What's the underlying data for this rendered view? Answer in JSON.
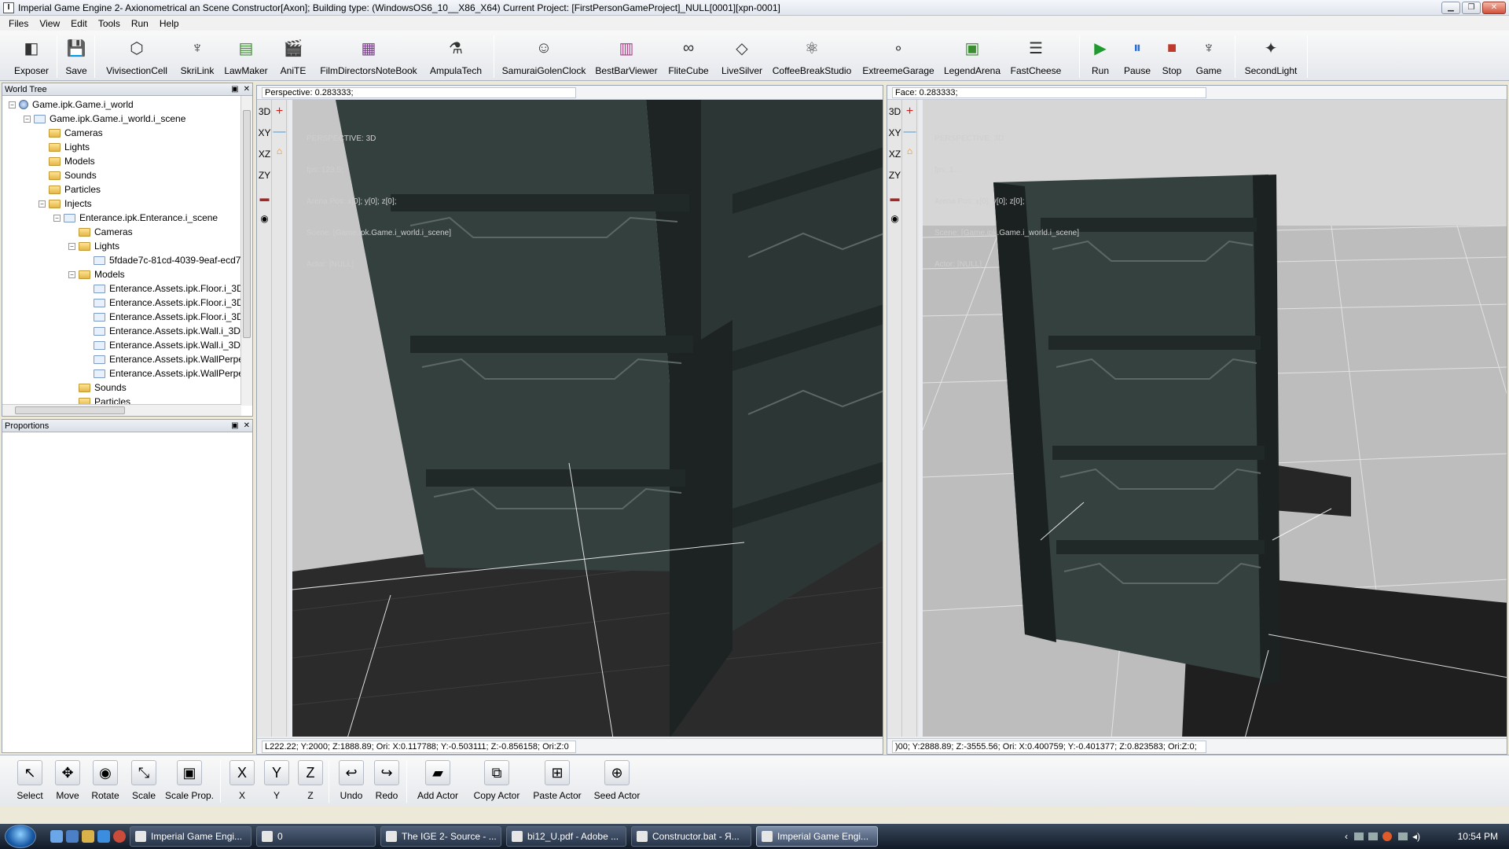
{
  "window": {
    "title": "Imperial Game Engine 2- Axionometrical an Scene Constructor[Axon]; Building type: (WindowsOS6_10__X86_X64) Current Project: [FirstPersonGameProject]_NULL[0001][xpn-0001]",
    "icon_letter": "I"
  },
  "menu": [
    "Files",
    "View",
    "Edit",
    "Tools",
    "Run",
    "Help"
  ],
  "toolbar": [
    {
      "label": "Exposer",
      "icon": "camera-icon"
    },
    {
      "label": "Save",
      "icon": "save-icon"
    },
    {
      "label": "VivisectionCell",
      "icon": "cube-icon"
    },
    {
      "label": "SkriLink",
      "icon": "eagle-icon"
    },
    {
      "label": "LawMaker",
      "icon": "chart-icon"
    },
    {
      "label": "AniTE",
      "icon": "clapperboard-icon"
    },
    {
      "label": "FilmDirectorsNoteBook",
      "icon": "film-icon"
    },
    {
      "label": "AmpulaTech",
      "icon": "ampule-icon"
    },
    {
      "label": "SamuraiGolenClock",
      "icon": "masks-icon"
    },
    {
      "label": "BestBarViewer",
      "icon": "glass-icon"
    },
    {
      "label": "FliteCube",
      "icon": "loop-icon"
    },
    {
      "label": "LiveSilver",
      "icon": "diamond-icon"
    },
    {
      "label": "CoffeeBreakStudio",
      "icon": "atom-icon"
    },
    {
      "label": "ExtreemeGarage",
      "icon": "spheres-icon"
    },
    {
      "label": "LegendArena",
      "icon": "arena-icon"
    },
    {
      "label": "FastCheese",
      "icon": "sliders-icon"
    },
    {
      "label": "Run",
      "icon": "run-icon"
    },
    {
      "label": "Pause",
      "icon": "pause-icon"
    },
    {
      "label": "Stop",
      "icon": "stop-icon"
    },
    {
      "label": "Game",
      "icon": "eagle-icon"
    },
    {
      "label": "SecondLight",
      "icon": "lamp-icon"
    }
  ],
  "world_tree": {
    "title": "World Tree",
    "items": [
      {
        "label": "Game.ipk.Game.i_world",
        "kind": "globe",
        "expander": "-",
        "indent": 0
      },
      {
        "label": "Game.ipk.Game.i_world.i_scene",
        "kind": "node",
        "expander": "-",
        "indent": 1
      },
      {
        "label": "Cameras",
        "kind": "folder",
        "expander": "",
        "indent": 2
      },
      {
        "label": "Lights",
        "kind": "folder",
        "expander": "",
        "indent": 2
      },
      {
        "label": "Models",
        "kind": "folder",
        "expander": "",
        "indent": 2
      },
      {
        "label": "Sounds",
        "kind": "folder",
        "expander": "",
        "indent": 2
      },
      {
        "label": "Particles",
        "kind": "folder",
        "expander": "",
        "indent": 2
      },
      {
        "label": "Injects",
        "kind": "folder",
        "expander": "-",
        "indent": 2
      },
      {
        "label": "Enterance.ipk.Enterance.i_scene",
        "kind": "node",
        "expander": "-",
        "indent": 3
      },
      {
        "label": "Cameras",
        "kind": "folder",
        "expander": "",
        "indent": 4
      },
      {
        "label": "Lights",
        "kind": "folder",
        "expander": "-",
        "indent": 4
      },
      {
        "label": "5fdade7c-81cd-4039-9eaf-ecd7",
        "kind": "node",
        "expander": "",
        "indent": 5
      },
      {
        "label": "Models",
        "kind": "folder",
        "expander": "-",
        "indent": 4
      },
      {
        "label": "Enterance.Assets.ipk.Floor.i_3D",
        "kind": "node",
        "expander": "",
        "indent": 5
      },
      {
        "label": "Enterance.Assets.ipk.Floor.i_3D",
        "kind": "node",
        "expander": "",
        "indent": 5
      },
      {
        "label": "Enterance.Assets.ipk.Floor.i_3D",
        "kind": "node",
        "expander": "",
        "indent": 5
      },
      {
        "label": "Enterance.Assets.ipk.Wall.i_3D_",
        "kind": "node",
        "expander": "",
        "indent": 5
      },
      {
        "label": "Enterance.Assets.ipk.Wall.i_3D_",
        "kind": "node",
        "expander": "",
        "indent": 5
      },
      {
        "label": "Enterance.Assets.ipk.WallPerpe",
        "kind": "node",
        "expander": "",
        "indent": 5
      },
      {
        "label": "Enterance.Assets.ipk.WallPerpe",
        "kind": "node",
        "expander": "",
        "indent": 5
      },
      {
        "label": "Sounds",
        "kind": "folder",
        "expander": "",
        "indent": 4
      },
      {
        "label": "Particles",
        "kind": "folder",
        "expander": "",
        "indent": 4
      }
    ]
  },
  "proportions": {
    "title": "Proportions"
  },
  "panel_buttons": {
    "dock": "▣",
    "close": "✕"
  },
  "viewport_left": {
    "header": "Perspective: 0.283333;",
    "status": "L222.22; Y:2000; Z:1888.89; Ori: X:0.117788; Y:-0.503111; Z:-0.856158; Ori:Z:0",
    "overlay": [
      "PERSPECTIVE: 3D",
      "fps: 123.5;",
      "Arena Pos: x[0]; y[0]; z[0];",
      "Scene: [Game.ipk.Game.i_world.i_scene]",
      "Actor: [NULL]"
    ]
  },
  "viewport_right": {
    "header": "Face: 0.283333;",
    "status": ")00; Y:2888.89; Z:-3555.56; Ori: X:0.400759; Y:-0.401377; Z:0.823583; Ori:Z:0;",
    "overlay": [
      "PERSPECTIVE: 3D",
      "fps: 1...",
      "Arena Pos: x[0]; y[0]; z[0];",
      "Scene: [Game.ipk.Game.i_world.i_scene]",
      "Actor: [NULL]"
    ]
  },
  "viewport_tools": [
    "3D",
    "XY",
    "XZ",
    "ZY"
  ],
  "bottom_tools": [
    {
      "label": "Select",
      "glyph": "↖"
    },
    {
      "label": "Move",
      "glyph": "✥"
    },
    {
      "label": "Rotate",
      "glyph": "◉"
    },
    {
      "label": "Scale",
      "glyph": "⤡"
    },
    {
      "label": "Scale Prop.",
      "glyph": "▣"
    },
    {
      "label": "X",
      "glyph": "X"
    },
    {
      "label": "Y",
      "glyph": "Y"
    },
    {
      "label": "Z",
      "glyph": "Z"
    },
    {
      "label": "Undo",
      "glyph": "↩"
    },
    {
      "label": "Redo",
      "glyph": "↪"
    },
    {
      "label": "Add Actor",
      "glyph": "▰"
    },
    {
      "label": "Copy Actor",
      "glyph": "⧉"
    },
    {
      "label": "Paste Actor",
      "glyph": "⊞"
    },
    {
      "label": "Seed Actor",
      "glyph": "⊕"
    }
  ],
  "taskbar": {
    "tasks": [
      "Imperial Game Engi...",
      "0",
      "The IGE 2- Source - ...",
      "bi12_U.pdf - Adobe ...",
      "Constructor.bat - Я...",
      "Imperial Game Engi..."
    ],
    "clock": "10:54 PM"
  },
  "colors": {
    "accent": "#2a5ea8",
    "viewport_bg": "#c8c8c8",
    "wall": "#2f3a38"
  }
}
